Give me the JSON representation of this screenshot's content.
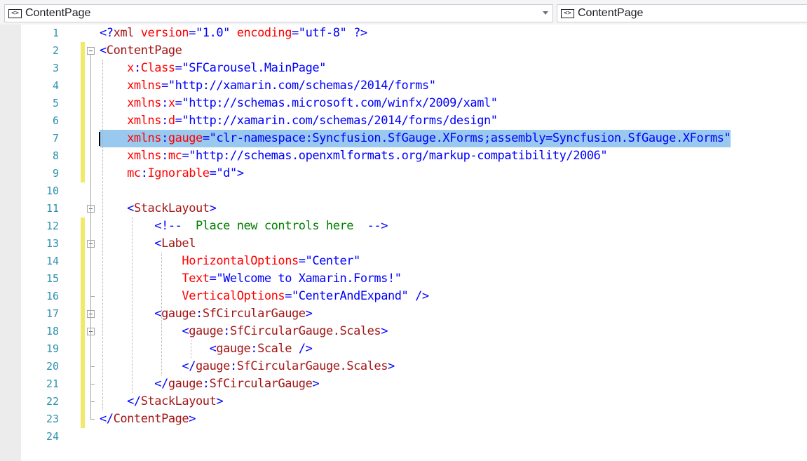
{
  "navbar": {
    "left_combo": {
      "icon": "xml-element-icon",
      "value": "ContentPage"
    },
    "right_combo": {
      "icon": "xml-element-icon",
      "value": "ContentPage"
    }
  },
  "colors": {
    "line_number": "#2b91af",
    "keyword_blue": "#0000ff",
    "element_maroon": "#a31515",
    "attribute_red": "#ff0000",
    "comment_green": "#008000",
    "selection": "#99c9ef",
    "change_bar": "#f2e96b"
  },
  "editor": {
    "lines": [
      {
        "num": "1",
        "tokens": [
          [
            "b",
            "<?"
          ],
          [
            "m",
            "xml"
          ],
          [
            "r",
            " version"
          ],
          [
            "b",
            "=\"1.0\" "
          ],
          [
            "r",
            "encoding"
          ],
          [
            "b",
            "=\"utf-8\" ?>"
          ]
        ]
      },
      {
        "num": "2",
        "tokens": [
          [
            "b",
            "<"
          ],
          [
            "m",
            "ContentPage"
          ]
        ]
      },
      {
        "num": "3",
        "tokens": [
          [
            "k",
            "    "
          ],
          [
            "r",
            "x"
          ],
          [
            "b",
            ":"
          ],
          [
            "r",
            "Class"
          ],
          [
            "b",
            "=\"SFCarousel.MainPage\""
          ]
        ]
      },
      {
        "num": "4",
        "tokens": [
          [
            "k",
            "    "
          ],
          [
            "r",
            "xmlns"
          ],
          [
            "b",
            "=\"http://xamarin.com/schemas/2014/forms\""
          ]
        ]
      },
      {
        "num": "5",
        "tokens": [
          [
            "k",
            "    "
          ],
          [
            "r",
            "xmlns"
          ],
          [
            "b",
            ":"
          ],
          [
            "r",
            "x"
          ],
          [
            "b",
            "=\"http://schemas.microsoft.com/winfx/2009/xaml\""
          ]
        ]
      },
      {
        "num": "6",
        "tokens": [
          [
            "k",
            "    "
          ],
          [
            "r",
            "xmlns"
          ],
          [
            "b",
            ":"
          ],
          [
            "r",
            "d"
          ],
          [
            "b",
            "=\"http://xamarin.com/schemas/2014/forms/design\""
          ]
        ]
      },
      {
        "num": "7",
        "tokens": [
          [
            "k",
            "    "
          ],
          [
            "r",
            "xmlns"
          ],
          [
            "b",
            ":"
          ],
          [
            "r",
            "gauge"
          ],
          [
            "b",
            "=\"clr-namespace:Syncfusion.SfGauge.XForms;assembly=Syncfusion.SfGauge.XForms\""
          ]
        ]
      },
      {
        "num": "8",
        "tokens": [
          [
            "k",
            "    "
          ],
          [
            "r",
            "xmlns"
          ],
          [
            "b",
            ":"
          ],
          [
            "r",
            "mc"
          ],
          [
            "b",
            "=\"http://schemas.openxmlformats.org/markup-compatibility/2006\""
          ]
        ]
      },
      {
        "num": "9",
        "tokens": [
          [
            "k",
            "    "
          ],
          [
            "r",
            "mc"
          ],
          [
            "b",
            ":"
          ],
          [
            "r",
            "Ignorable"
          ],
          [
            "b",
            "=\"d\">"
          ]
        ]
      },
      {
        "num": "10",
        "tokens": []
      },
      {
        "num": "11",
        "tokens": [
          [
            "k",
            "    "
          ],
          [
            "b",
            "<"
          ],
          [
            "m",
            "StackLayout"
          ],
          [
            "b",
            ">"
          ]
        ]
      },
      {
        "num": "12",
        "tokens": [
          [
            "k",
            "        "
          ],
          [
            "b",
            "<!--"
          ],
          [
            "g",
            "  Place new controls here  "
          ],
          [
            "b",
            "-->"
          ]
        ]
      },
      {
        "num": "13",
        "tokens": [
          [
            "k",
            "        "
          ],
          [
            "b",
            "<"
          ],
          [
            "m",
            "Label"
          ]
        ]
      },
      {
        "num": "14",
        "tokens": [
          [
            "k",
            "            "
          ],
          [
            "r",
            "HorizontalOptions"
          ],
          [
            "b",
            "=\"Center\""
          ]
        ]
      },
      {
        "num": "15",
        "tokens": [
          [
            "k",
            "            "
          ],
          [
            "r",
            "Text"
          ],
          [
            "b",
            "=\"Welcome to Xamarin.Forms!\""
          ]
        ]
      },
      {
        "num": "16",
        "tokens": [
          [
            "k",
            "            "
          ],
          [
            "r",
            "VerticalOptions"
          ],
          [
            "b",
            "=\"CenterAndExpand\" />"
          ]
        ]
      },
      {
        "num": "17",
        "tokens": [
          [
            "k",
            "        "
          ],
          [
            "b",
            "<"
          ],
          [
            "m",
            "gauge"
          ],
          [
            "b",
            ":"
          ],
          [
            "m",
            "SfCircularGauge"
          ],
          [
            "b",
            ">"
          ]
        ]
      },
      {
        "num": "18",
        "tokens": [
          [
            "k",
            "            "
          ],
          [
            "b",
            "<"
          ],
          [
            "m",
            "gauge"
          ],
          [
            "b",
            ":"
          ],
          [
            "m",
            "SfCircularGauge.Scales"
          ],
          [
            "b",
            ">"
          ]
        ]
      },
      {
        "num": "19",
        "tokens": [
          [
            "k",
            "                "
          ],
          [
            "b",
            "<"
          ],
          [
            "m",
            "gauge"
          ],
          [
            "b",
            ":"
          ],
          [
            "m",
            "Scale"
          ],
          [
            "b",
            " />"
          ]
        ]
      },
      {
        "num": "20",
        "tokens": [
          [
            "k",
            "            "
          ],
          [
            "b",
            "</"
          ],
          [
            "m",
            "gauge"
          ],
          [
            "b",
            ":"
          ],
          [
            "m",
            "SfCircularGauge.Scales"
          ],
          [
            "b",
            ">"
          ]
        ]
      },
      {
        "num": "21",
        "tokens": [
          [
            "k",
            "        "
          ],
          [
            "b",
            "</"
          ],
          [
            "m",
            "gauge"
          ],
          [
            "b",
            ":"
          ],
          [
            "m",
            "SfCircularGauge"
          ],
          [
            "b",
            ">"
          ]
        ]
      },
      {
        "num": "22",
        "tokens": [
          [
            "k",
            "    "
          ],
          [
            "b",
            "</"
          ],
          [
            "m",
            "StackLayout"
          ],
          [
            "b",
            ">"
          ]
        ]
      },
      {
        "num": "23",
        "tokens": [
          [
            "b",
            "</"
          ],
          [
            "m",
            "ContentPage"
          ],
          [
            "b",
            ">"
          ]
        ]
      },
      {
        "num": "24",
        "tokens": []
      }
    ]
  }
}
